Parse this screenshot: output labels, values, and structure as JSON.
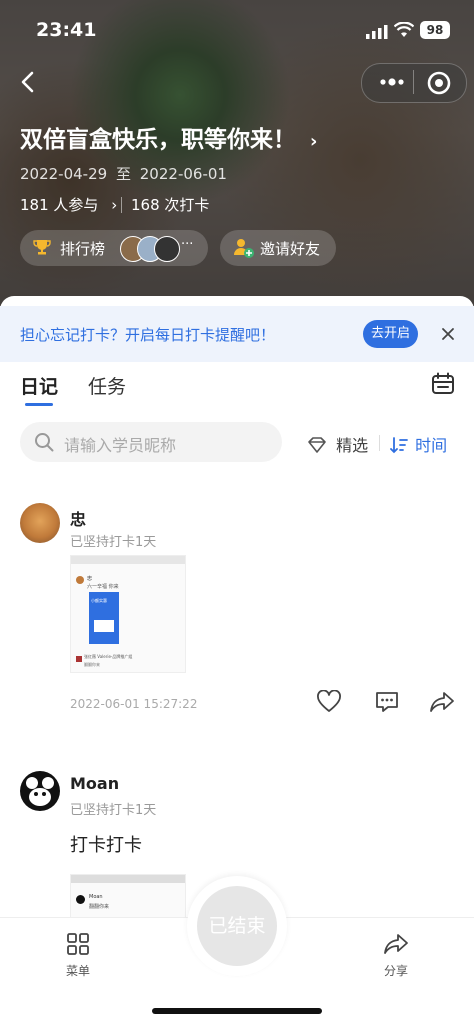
{
  "status_bar": {
    "time": "23:41",
    "battery": "98"
  },
  "header": {
    "title": "双倍盲盒快乐，职等你来！",
    "date_start": "2022-04-29",
    "date_sep": "至",
    "date_end": "2022-06-01",
    "participants": "181 人参与",
    "checkins": "168 次打卡",
    "ranking_label": "排行榜",
    "invite_label": "邀请好友"
  },
  "reminder": {
    "text": "担心忘记打卡？开启每日打卡提醒吧！",
    "button": "去开启"
  },
  "tabs": [
    {
      "label": "日记"
    },
    {
      "label": "任务"
    }
  ],
  "search": {
    "placeholder": "请输入学员昵称"
  },
  "filters": {
    "featured": "精选",
    "time": "时间"
  },
  "posts": [
    {
      "author": "忠",
      "streak": "已坚持打卡1天",
      "text": "",
      "timestamp": "2022-06-01 15:27:22",
      "thumb": {
        "name": "忠",
        "caption": "六一辛福 你来",
        "inner_title": "小额实惠",
        "comment": "张红薇 Valerie-品牌推广组",
        "comment2": "翻翻你来"
      }
    },
    {
      "author": "Moan",
      "streak": "已坚持打卡1天",
      "text": "打卡打卡",
      "thumb": {
        "name": "Moan",
        "caption": "翻翻你来"
      }
    }
  ],
  "bottom_bar": {
    "menu": "菜单",
    "ended": "已结束",
    "share": "分享"
  },
  "colors": {
    "accent": "#2f6fe0"
  }
}
